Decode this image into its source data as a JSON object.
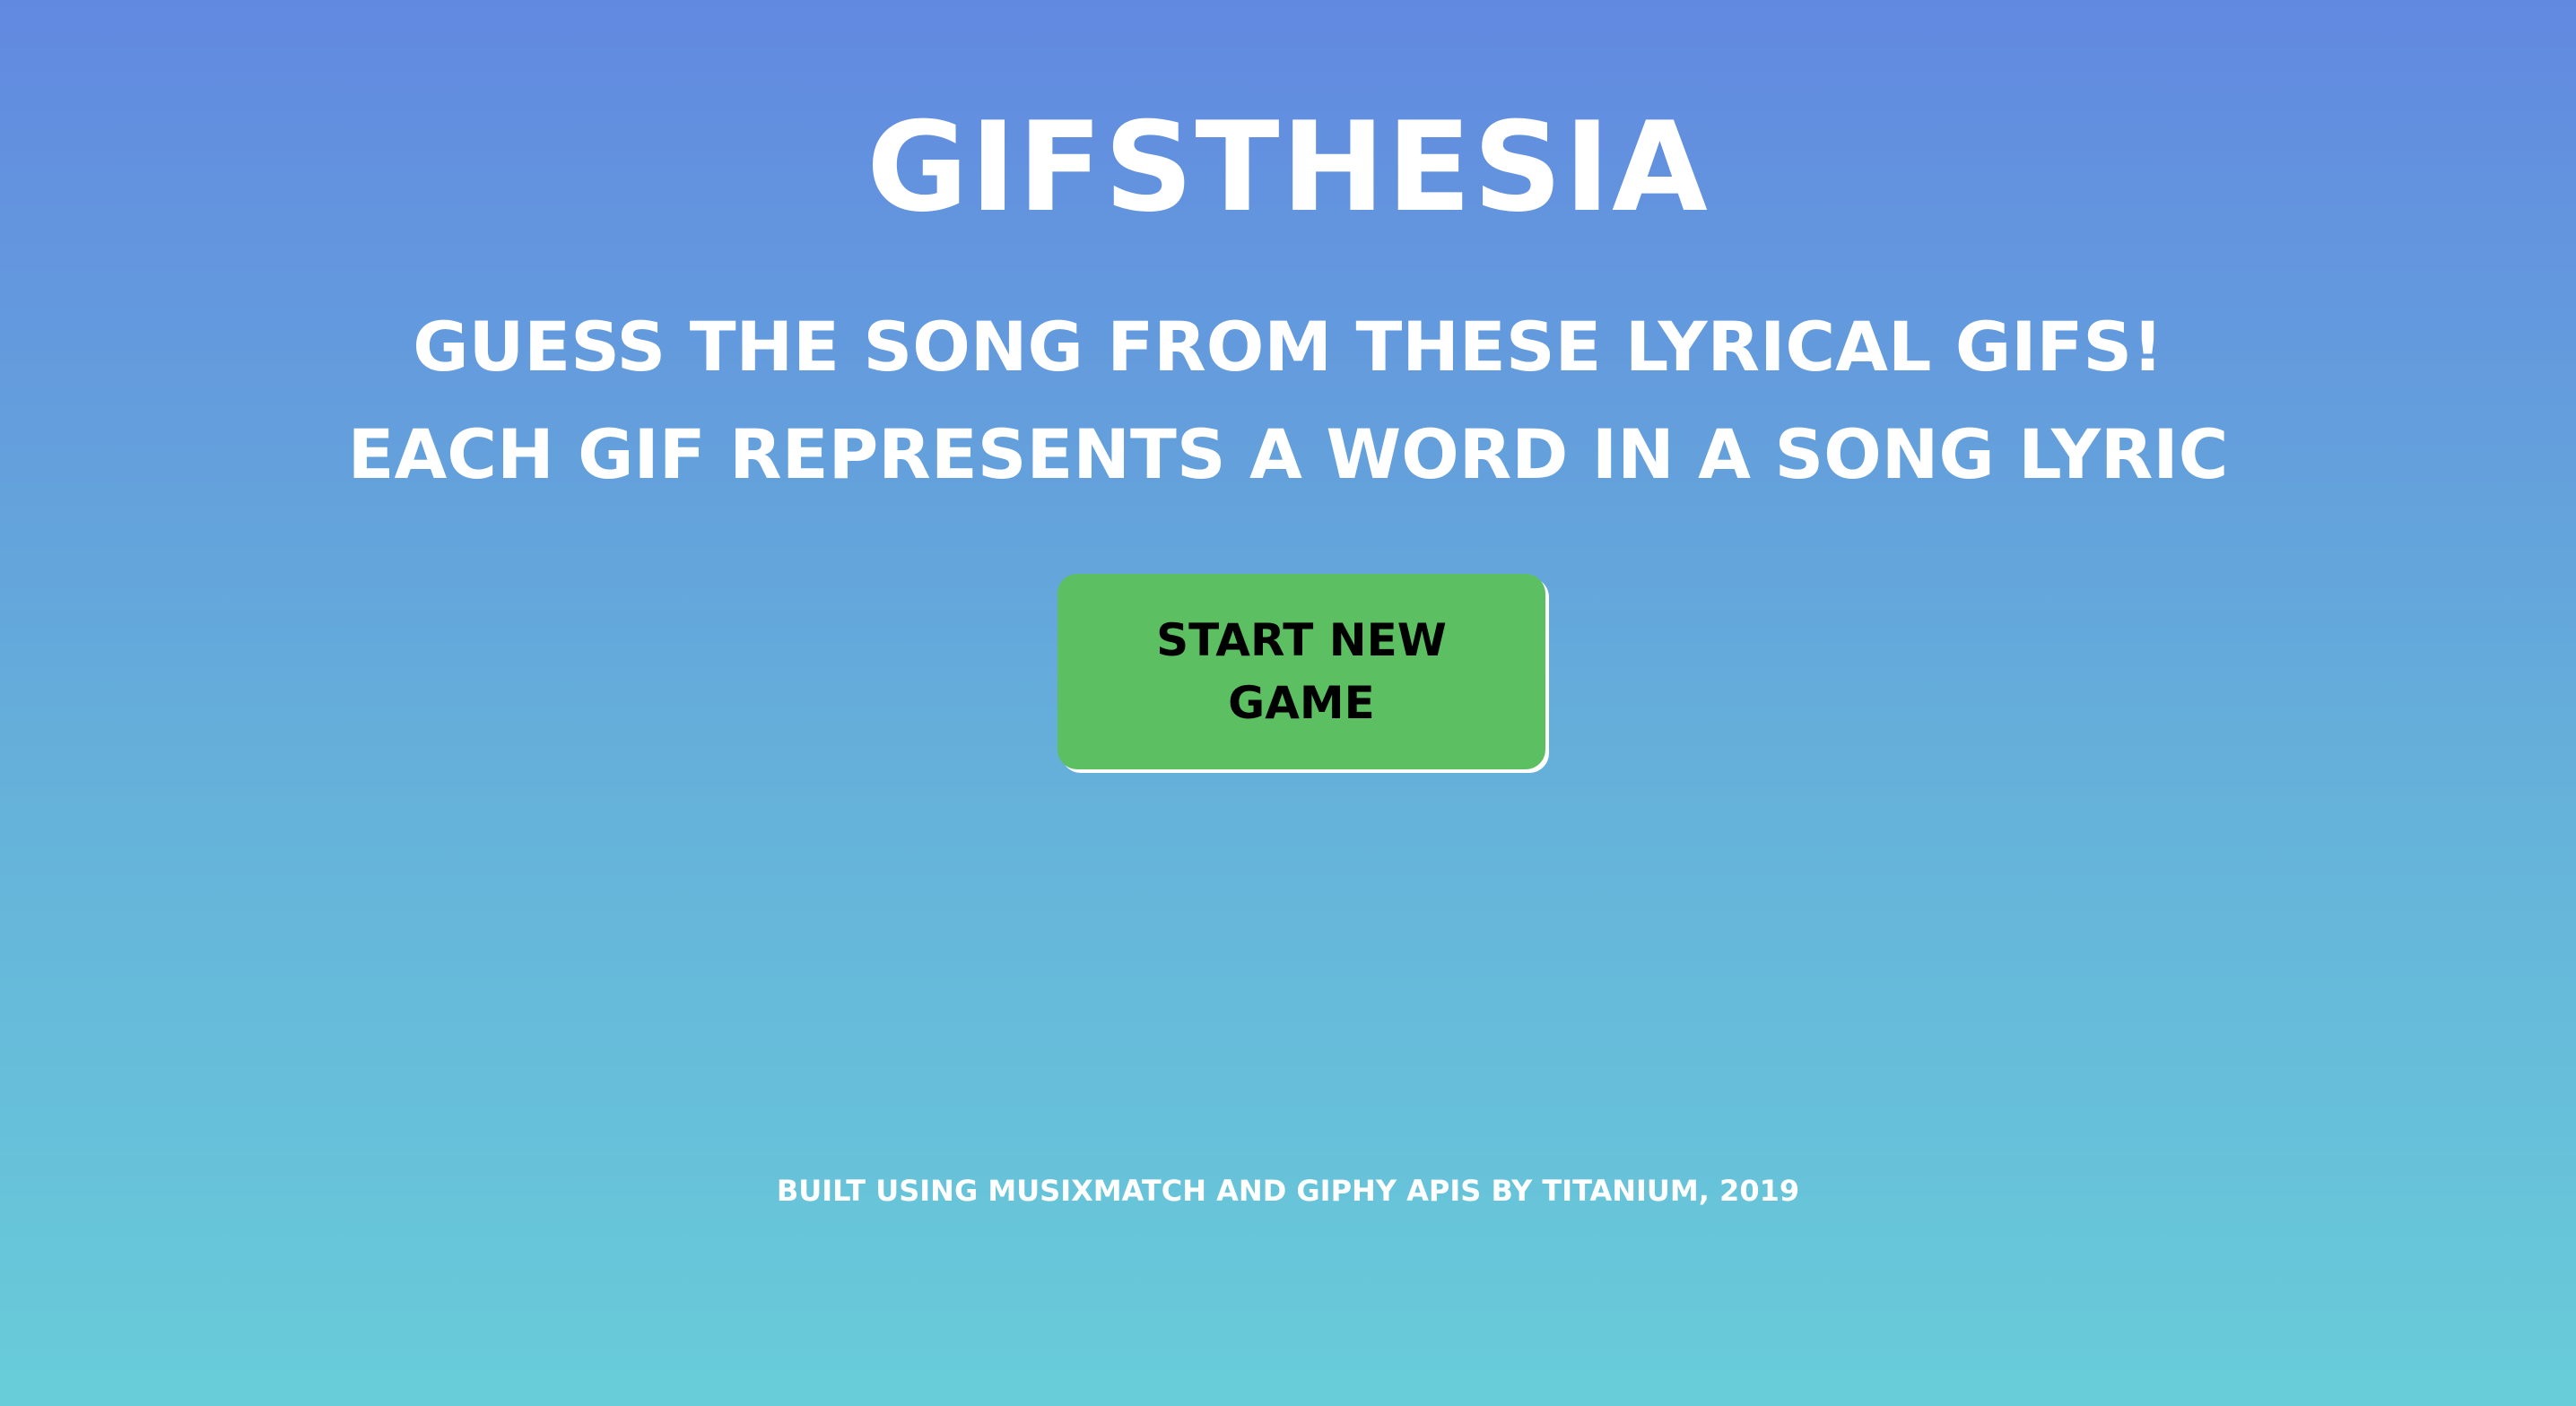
{
  "header": {
    "title": "GIFSTHESIA",
    "subtitle_line1": "GUESS THE SONG FROM THESE LYRICAL GIFS!",
    "subtitle_line2": "EACH GIF REPRESENTS A WORD IN A SONG LYRIC"
  },
  "main": {
    "start_button_label": "START NEW GAME"
  },
  "footer": {
    "credit": "BUILT USING MUSIXMATCH AND GIPHY APIS BY TITANIUM, 2019"
  },
  "colors": {
    "background_top": "#6289e0",
    "background_bottom": "#68cdd9",
    "button": "#5cc062",
    "text": "#ffffff"
  }
}
